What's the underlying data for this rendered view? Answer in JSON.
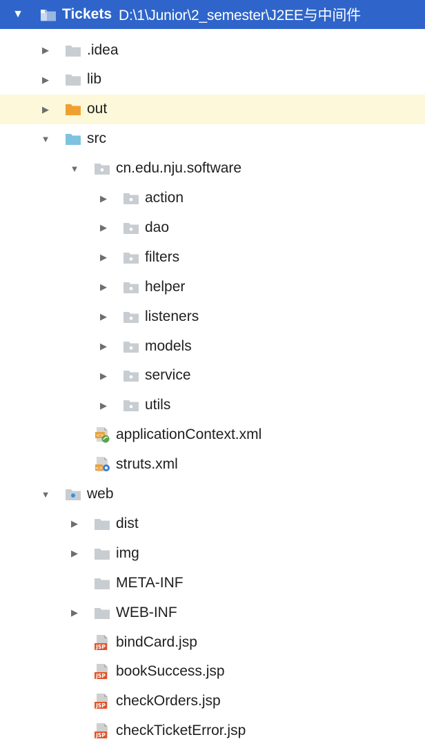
{
  "colors": {
    "root_bar": "#2f65ca",
    "highlight_row": "#fdf8d9",
    "folder_gray": "#c8cdd2",
    "folder_orange": "#f0a030",
    "folder_source": "#7ec2e0",
    "jsp_badge": "#e2542a",
    "spring_green": "#5aa34a"
  },
  "root": {
    "name": "Tickets",
    "path": "D:\\1\\Junior\\2_semester\\J2EE与中间件",
    "expanded": true
  },
  "tree": [
    {
      "label": ".idea",
      "icon": "folder-icon",
      "depth": 1,
      "arrow": "collapsed"
    },
    {
      "label": "lib",
      "icon": "folder-icon",
      "depth": 1,
      "arrow": "collapsed"
    },
    {
      "label": "out",
      "icon": "excluded-folder-icon",
      "depth": 1,
      "arrow": "collapsed",
      "highlighted": true
    },
    {
      "label": "src",
      "icon": "source-folder-icon",
      "depth": 1,
      "arrow": "expanded"
    },
    {
      "label": "cn.edu.nju.software",
      "icon": "package-icon",
      "depth": 2,
      "arrow": "expanded"
    },
    {
      "label": "action",
      "icon": "package-icon",
      "depth": 3,
      "arrow": "collapsed"
    },
    {
      "label": "dao",
      "icon": "package-icon",
      "depth": 3,
      "arrow": "collapsed"
    },
    {
      "label": "filters",
      "icon": "package-icon",
      "depth": 3,
      "arrow": "collapsed"
    },
    {
      "label": "helper",
      "icon": "package-icon",
      "depth": 3,
      "arrow": "collapsed"
    },
    {
      "label": "listeners",
      "icon": "package-icon",
      "depth": 3,
      "arrow": "collapsed"
    },
    {
      "label": "models",
      "icon": "package-icon",
      "depth": 3,
      "arrow": "collapsed"
    },
    {
      "label": "service",
      "icon": "package-icon",
      "depth": 3,
      "arrow": "collapsed"
    },
    {
      "label": "utils",
      "icon": "package-icon",
      "depth": 3,
      "arrow": "collapsed"
    },
    {
      "label": "applicationContext.xml",
      "icon": "spring-xml-icon",
      "depth": 2,
      "arrow": "none"
    },
    {
      "label": "struts.xml",
      "icon": "struts-xml-icon",
      "depth": 2,
      "arrow": "none"
    },
    {
      "label": "web",
      "icon": "web-folder-icon",
      "depth": 1,
      "arrow": "expanded"
    },
    {
      "label": "dist",
      "icon": "folder-icon",
      "depth": 2,
      "arrow": "collapsed"
    },
    {
      "label": "img",
      "icon": "folder-icon",
      "depth": 2,
      "arrow": "collapsed"
    },
    {
      "label": "META-INF",
      "icon": "folder-icon",
      "depth": 2,
      "arrow": "none"
    },
    {
      "label": "WEB-INF",
      "icon": "folder-icon",
      "depth": 2,
      "arrow": "collapsed"
    },
    {
      "label": "bindCard.jsp",
      "icon": "jsp-file-icon",
      "depth": 2,
      "arrow": "none"
    },
    {
      "label": "bookSuccess.jsp",
      "icon": "jsp-file-icon",
      "depth": 2,
      "arrow": "none"
    },
    {
      "label": "checkOrders.jsp",
      "icon": "jsp-file-icon",
      "depth": 2,
      "arrow": "none"
    },
    {
      "label": "checkTicketError.jsp",
      "icon": "jsp-file-icon",
      "depth": 2,
      "arrow": "none"
    }
  ]
}
